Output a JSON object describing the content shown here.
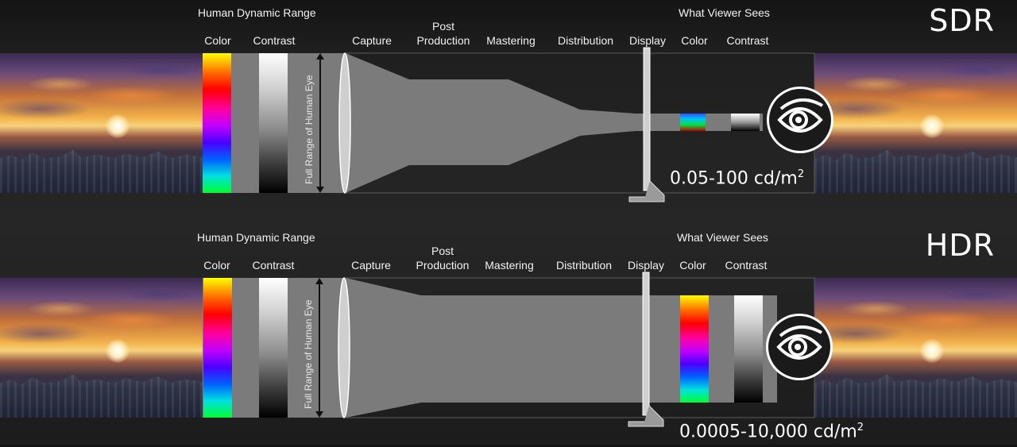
{
  "panels": [
    {
      "mode": "SDR",
      "luminance": {
        "text": "0.05-100 cd/m",
        "superscript": "2"
      },
      "group_left": "Human Dynamic Range",
      "group_right": "What Viewer Sees",
      "stages": {
        "color": "Color",
        "contrast": "Contrast",
        "capture": "Capture",
        "post_line1": "Post",
        "post_line2": "Production",
        "mastering": "Mastering",
        "distribution": "Distribution",
        "display": "Display",
        "viewer_color": "Color",
        "viewer_contrast": "Contrast"
      },
      "vertical_label": "Full Range of Human Eye"
    },
    {
      "mode": "HDR",
      "luminance": {
        "text": "0.0005-10,000 cd/m",
        "superscript": "2"
      },
      "group_left": "Human Dynamic Range",
      "group_right": "What Viewer Sees",
      "stages": {
        "color": "Color",
        "contrast": "Contrast",
        "capture": "Capture",
        "post_line1": "Post",
        "post_line2": "Production",
        "mastering": "Mastering",
        "distribution": "Distribution",
        "display": "Display",
        "viewer_color": "Color",
        "viewer_contrast": "Contrast"
      },
      "vertical_label": "Full Range of Human Eye"
    }
  ],
  "icons": [
    "eye-icon",
    "monitor-icon",
    "lens-icon",
    "range-arrow-icon"
  ],
  "colors": {
    "funnel_gray": "#7b7b7b",
    "background": "#262626",
    "text": "#ffffff"
  }
}
